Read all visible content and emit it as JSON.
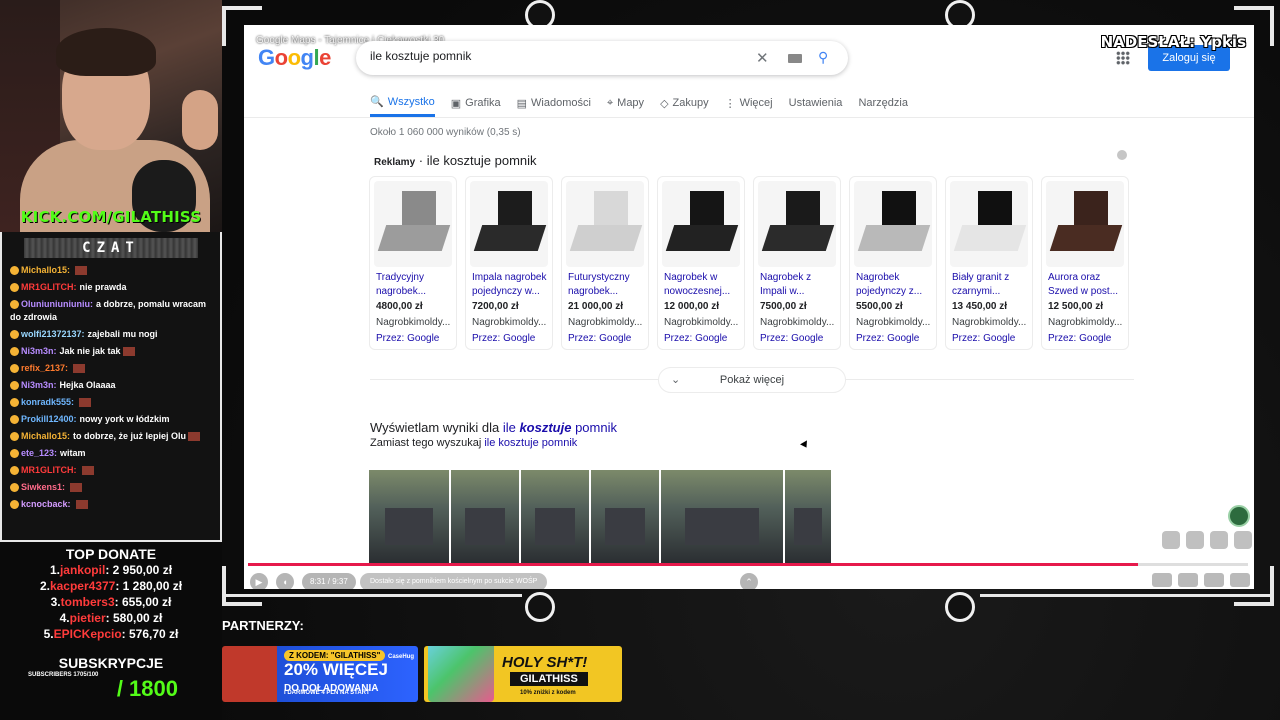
{
  "stream": {
    "kick_label": "KICK.COM/GILATHISS",
    "submitted_by": "NADESŁAŁ: Ypkis",
    "partners_label": "PARTNERZY:"
  },
  "chat": {
    "header": "CZAT",
    "messages": [
      {
        "user": "Michallo15:",
        "text": "",
        "color": "#f5b335",
        "emote": true
      },
      {
        "user": "MR1GLITCH:",
        "text": "nie prawda",
        "color": "#ff3b3b",
        "emote": false
      },
      {
        "user": "Oluniuniuniuniu:",
        "text": "a dobrze, pomalu wracam do zdrowia",
        "color": "#b78cff",
        "emote": false
      },
      {
        "user": "wolfi21372137:",
        "text": "zajebali mu nogi",
        "color": "#9ad8ff",
        "emote": false
      },
      {
        "user": "Ni3m3n:",
        "text": "Jak nie jak tak",
        "color": "#b78cff",
        "emote": true
      },
      {
        "user": "refix_2137:",
        "text": "",
        "color": "#ff7b2e",
        "emote": true
      },
      {
        "user": "Ni3m3n:",
        "text": "Hejka Olaaaa",
        "color": "#b78cff",
        "emote": false
      },
      {
        "user": "konradk555:",
        "text": "",
        "color": "#6fb7ff",
        "emote": true
      },
      {
        "user": "Prokill12400:",
        "text": "nowy york w łódzkim",
        "color": "#6fb7ff",
        "emote": false
      },
      {
        "user": "Michallo15:",
        "text": "to dobrze, że już lepiej Olu",
        "color": "#f5b335",
        "emote": true
      },
      {
        "user": "ete_123:",
        "text": "witam",
        "color": "#b78cff",
        "emote": false
      },
      {
        "user": "MR1GLITCH:",
        "text": "",
        "color": "#ff3b3b",
        "emote": true
      },
      {
        "user": "Siwkens1:",
        "text": "",
        "color": "#ff6b8a",
        "emote": true
      },
      {
        "user": "kcnocback:",
        "text": "",
        "color": "#d49cff",
        "emote": true
      }
    ]
  },
  "donate": {
    "title": "TOP DONATE",
    "rows": [
      {
        "rank": "1.",
        "name": "jankopil",
        "amount": ": 2 950,00 zł"
      },
      {
        "rank": "2.",
        "name": "kacper4377",
        "amount": ": 1 280,00 zł"
      },
      {
        "rank": "3.",
        "name": "tombers3",
        "amount": ": 655,00 zł"
      },
      {
        "rank": "4.",
        "name": "pietier",
        "amount": ": 580,00 zł"
      },
      {
        "rank": "5.",
        "name": "EPICKepcio",
        "amount": ": 576,70 zł"
      }
    ]
  },
  "subs": {
    "title": "SUBSKRYPCJE",
    "small": "SUBSCRIBERS 1705/100",
    "goal": "/ 1800"
  },
  "banners": {
    "b1_code": "Z KODEM: \"GILATHISS\"",
    "b1_big": "20% WIĘCEJ",
    "b1_big2": "DO DOŁADOWANIA",
    "b1_small": "I DARMOWE 4 PLN NA START",
    "b1_brand": "CaseHug",
    "b2_title": "HOLY SH*T!",
    "b2_code": "GILATHISS",
    "b2_small": "10% zniżki z kodem"
  },
  "browser": {
    "video_title": "Google Maps - Tajemnice i Ciekawostki 30",
    "logo": [
      "G",
      "o",
      "o",
      "g",
      "l",
      "e"
    ],
    "search_value": "ile kosztuje pomnik",
    "login": "Zaloguj się",
    "tabs": [
      {
        "label": "Wszystko",
        "icon": "🔍",
        "active": true
      },
      {
        "label": "Grafika",
        "icon": "▣",
        "active": false
      },
      {
        "label": "Wiadomości",
        "icon": "▤",
        "active": false
      },
      {
        "label": "Mapy",
        "icon": "⌖",
        "active": false
      },
      {
        "label": "Zakupy",
        "icon": "◇",
        "active": false
      },
      {
        "label": "Więcej",
        "icon": "⋮",
        "active": false
      },
      {
        "label": "Ustawienia",
        "icon": "",
        "active": false
      },
      {
        "label": "Narzędzia",
        "icon": "",
        "active": false
      }
    ],
    "results_count": "Około 1 060 000 wyników (0,35 s)",
    "ads_prefix": "Reklamy",
    "ads_sep": " · ",
    "ads_query": "ile kosztuje pomnik",
    "products": [
      {
        "name": "Tradycyjny nagrobek...",
        "price": "4800,00 zł",
        "shop": "Nagrobkimoldy...",
        "via": "Przez: Google",
        "stone": "#8a8a8a",
        "slab": "#9c9c9c"
      },
      {
        "name": "Impala nagrobek pojedynczy w...",
        "price": "7200,00 zł",
        "shop": "Nagrobkimoldy...",
        "via": "Przez: Google",
        "stone": "#1c1c1c",
        "slab": "#2a2a2a"
      },
      {
        "name": "Futurystyczny nagrobek...",
        "price": "21 000,00 zł",
        "shop": "Nagrobkimoldy...",
        "via": "Przez: Google",
        "stone": "#d8d8d8",
        "slab": "#cfcfcf"
      },
      {
        "name": "Nagrobek w nowoczesnej...",
        "price": "12 000,00 zł",
        "shop": "Nagrobkimoldy...",
        "via": "Przez: Google",
        "stone": "#151515",
        "slab": "#222"
      },
      {
        "name": "Nagrobek z Impali w...",
        "price": "7500,00 zł",
        "shop": "Nagrobkimoldy...",
        "via": "Przez: Google",
        "stone": "#1a1a1a",
        "slab": "#2b2b2b"
      },
      {
        "name": "Nagrobek pojedynczy z...",
        "price": "5500,00 zł",
        "shop": "Nagrobkimoldy...",
        "via": "Przez: Google",
        "stone": "#111",
        "slab": "#b9b9b9"
      },
      {
        "name": "Biały granit z czarnymi...",
        "price": "13 450,00 zł",
        "shop": "Nagrobkimoldy...",
        "via": "Przez: Google",
        "stone": "#101010",
        "slab": "#e5e5e5"
      },
      {
        "name": "Aurora oraz Szwed w post...",
        "price": "12 500,00 zł",
        "shop": "Nagrobkimoldy...",
        "via": "Przez: Google",
        "stone": "#3b231c",
        "slab": "#4a2c22"
      }
    ],
    "more": "Pokaż więcej",
    "spell_prefix": "Wyświetlam wyniki dla ",
    "spell_w1": "ile ",
    "spell_w2": "kosztuje",
    "spell_w3": " pomnik",
    "alt_prefix": "Zamiast tego wyszukaj ",
    "alt_query": "ile kosztuje pomnik"
  },
  "player": {
    "time": "8:31 / 9:37",
    "chapter": "Dostało się z pomnikiem kościelnym po sukcie WOŚP",
    "progress": 0.89
  }
}
